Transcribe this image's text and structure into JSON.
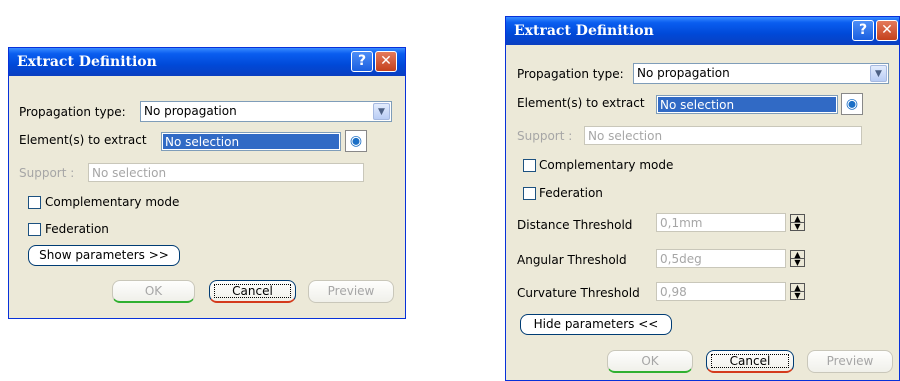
{
  "left": {
    "title": "Extract Definition",
    "help": "?",
    "close": "✕",
    "propagation_label": "Propagation type:",
    "propagation_value": "No propagation",
    "elements_label": "Element(s) to extract",
    "elements_value": "No selection",
    "support_label": "Support :",
    "support_value": "No selection",
    "complementary_label": "Complementary mode",
    "federation_label": "Federation",
    "params_button": "Show parameters >>",
    "ok": "OK",
    "cancel": "Cancel",
    "preview": "Preview"
  },
  "right": {
    "title": "Extract Definition",
    "help": "?",
    "close": "✕",
    "propagation_label": "Propagation type:",
    "propagation_value": "No propagation",
    "elements_label": "Element(s) to extract",
    "elements_value": "No selection",
    "support_label": "Support :",
    "support_value": "No selection",
    "complementary_label": "Complementary mode",
    "federation_label": "Federation",
    "distance_label": "Distance Threshold",
    "distance_value": "0,1mm",
    "angular_label": "Angular Threshold",
    "angular_value": "0,5deg",
    "curvature_label": "Curvature Threshold",
    "curvature_value": "0,98",
    "params_button": "Hide parameters <<",
    "ok": "OK",
    "cancel": "Cancel",
    "preview": "Preview"
  }
}
